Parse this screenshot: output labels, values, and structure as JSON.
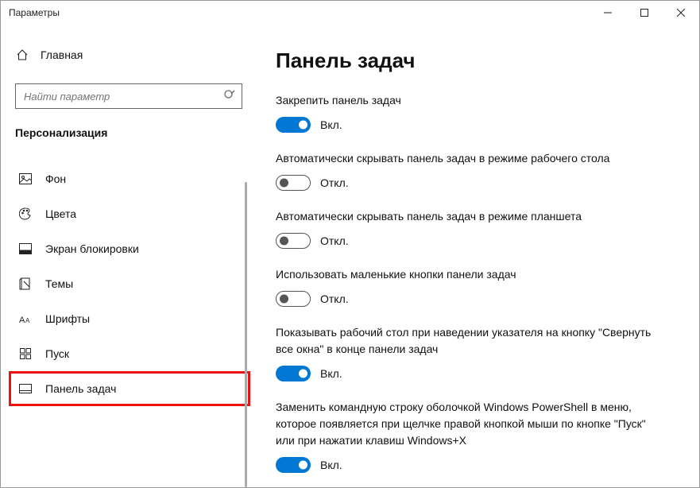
{
  "titlebar": {
    "title": "Параметры"
  },
  "sidebar": {
    "home": "Главная",
    "search_placeholder": "Найти параметр",
    "section": "Персонализация",
    "items": [
      {
        "label": "Фон"
      },
      {
        "label": "Цвета"
      },
      {
        "label": "Экран блокировки"
      },
      {
        "label": "Темы"
      },
      {
        "label": "Шрифты"
      },
      {
        "label": "Пуск"
      },
      {
        "label": "Панель задач"
      }
    ]
  },
  "content": {
    "title": "Панель задач",
    "toggle_on": "Вкл.",
    "toggle_off": "Откл.",
    "settings": [
      {
        "label": "Закрепить панель задач",
        "on": true
      },
      {
        "label": "Автоматически скрывать панель задач в режиме рабочего стола",
        "on": false
      },
      {
        "label": "Автоматически скрывать панель задач в режиме планшета",
        "on": false
      },
      {
        "label": "Использовать маленькие кнопки панели задач",
        "on": false
      },
      {
        "label": "Показывать рабочий стол при наведении указателя на кнопку \"Свернуть все окна\" в конце панели задач",
        "on": true
      },
      {
        "label": "Заменить командную строку оболочкой Windows PowerShell в меню, которое появляется при щелчке правой кнопкой мыши по кнопке \"Пуск\" или при нажатии клавиш Windows+X",
        "on": true
      }
    ]
  }
}
